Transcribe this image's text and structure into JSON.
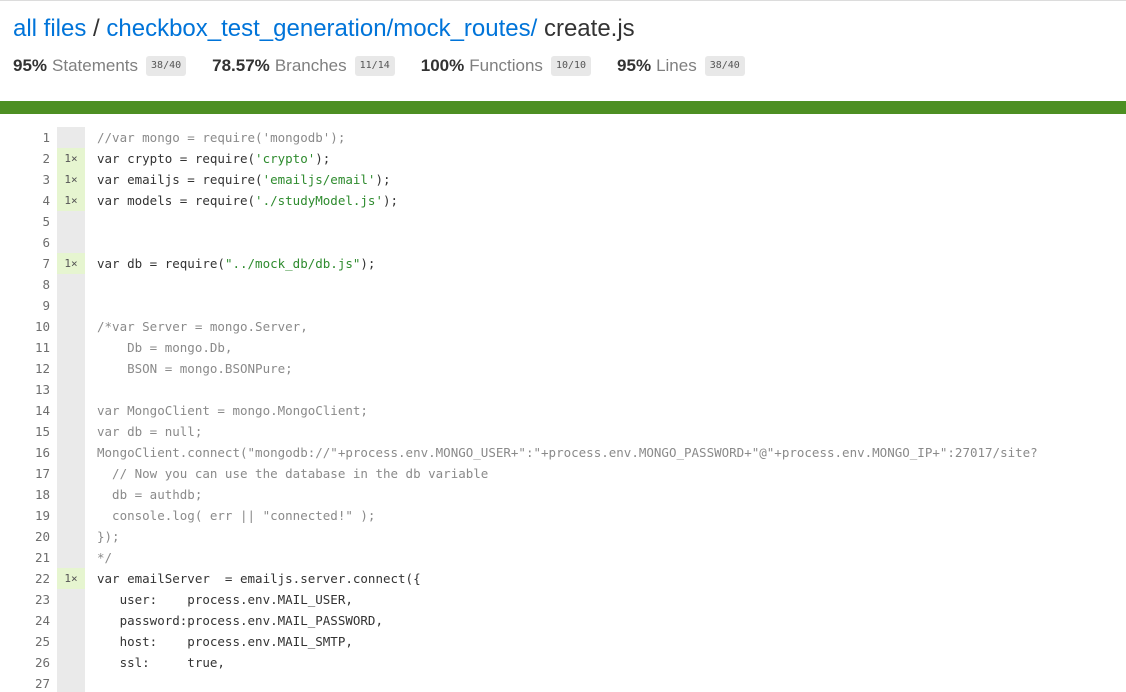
{
  "breadcrumb": {
    "root": "all files",
    "sep": " / ",
    "path": "checkbox_test_generation/mock_routes/",
    "file": "create.js"
  },
  "summary": [
    {
      "pct": "95%",
      "label": "Statements",
      "frac": "38/40"
    },
    {
      "pct": "78.57%",
      "label": "Branches",
      "frac": "11/14"
    },
    {
      "pct": "100%",
      "label": "Functions",
      "frac": "10/10"
    },
    {
      "pct": "95%",
      "label": "Lines",
      "frac": "38/40"
    }
  ],
  "colors": {
    "link": "#0074d9",
    "coverage_bar": "#4d8f22",
    "hit_gutter": "#e6f5d0",
    "neutral_gutter": "#eaeaea"
  },
  "lines": [
    {
      "n": "1",
      "count": "",
      "code": "//var mongo = require('mongodb');",
      "comment": true
    },
    {
      "n": "2",
      "count": "1×",
      "code": "var crypto = require('crypto');"
    },
    {
      "n": "3",
      "count": "1×",
      "code": "var emailjs = require('emailjs/email');"
    },
    {
      "n": "4",
      "count": "1×",
      "code": "var models = require('./studyModel.js');"
    },
    {
      "n": "5",
      "count": "",
      "code": ""
    },
    {
      "n": "6",
      "count": "",
      "code": ""
    },
    {
      "n": "7",
      "count": "1×",
      "code": "var db = require(\"../mock_db/db.js\");"
    },
    {
      "n": "8",
      "count": "",
      "code": ""
    },
    {
      "n": "9",
      "count": "",
      "code": ""
    },
    {
      "n": "10",
      "count": "",
      "code": "/*var Server = mongo.Server,",
      "comment": true
    },
    {
      "n": "11",
      "count": "",
      "code": "    Db = mongo.Db,",
      "comment": true
    },
    {
      "n": "12",
      "count": "",
      "code": "    BSON = mongo.BSONPure;",
      "comment": true
    },
    {
      "n": "13",
      "count": "",
      "code": "",
      "comment": true
    },
    {
      "n": "14",
      "count": "",
      "code": "var MongoClient = mongo.MongoClient;",
      "comment": true
    },
    {
      "n": "15",
      "count": "",
      "code": "var db = null;",
      "comment": true
    },
    {
      "n": "16",
      "count": "",
      "code": "MongoClient.connect(\"mongodb://\"+process.env.MONGO_USER+\":\"+process.env.MONGO_PASSWORD+\"@\"+process.env.MONGO_IP+\":27017/site?",
      "comment": true
    },
    {
      "n": "17",
      "count": "",
      "code": "  // Now you can use the database in the db variable",
      "comment": true
    },
    {
      "n": "18",
      "count": "",
      "code": "  db = authdb;",
      "comment": true
    },
    {
      "n": "19",
      "count": "",
      "code": "  console.log( err || \"connected!\" );",
      "comment": true
    },
    {
      "n": "20",
      "count": "",
      "code": "});",
      "comment": true
    },
    {
      "n": "21",
      "count": "",
      "code": "*/",
      "comment": true
    },
    {
      "n": "22",
      "count": "1×",
      "code": "var emailServer  = emailjs.server.connect({"
    },
    {
      "n": "23",
      "count": "",
      "code": "   user:    process.env.MAIL_USER,"
    },
    {
      "n": "24",
      "count": "",
      "code": "   password:process.env.MAIL_PASSWORD,"
    },
    {
      "n": "25",
      "count": "",
      "code": "   host:    process.env.MAIL_SMTP,"
    },
    {
      "n": "26",
      "count": "",
      "code": "   ssl:     true,"
    },
    {
      "n": "27",
      "count": "",
      "code": ""
    }
  ]
}
